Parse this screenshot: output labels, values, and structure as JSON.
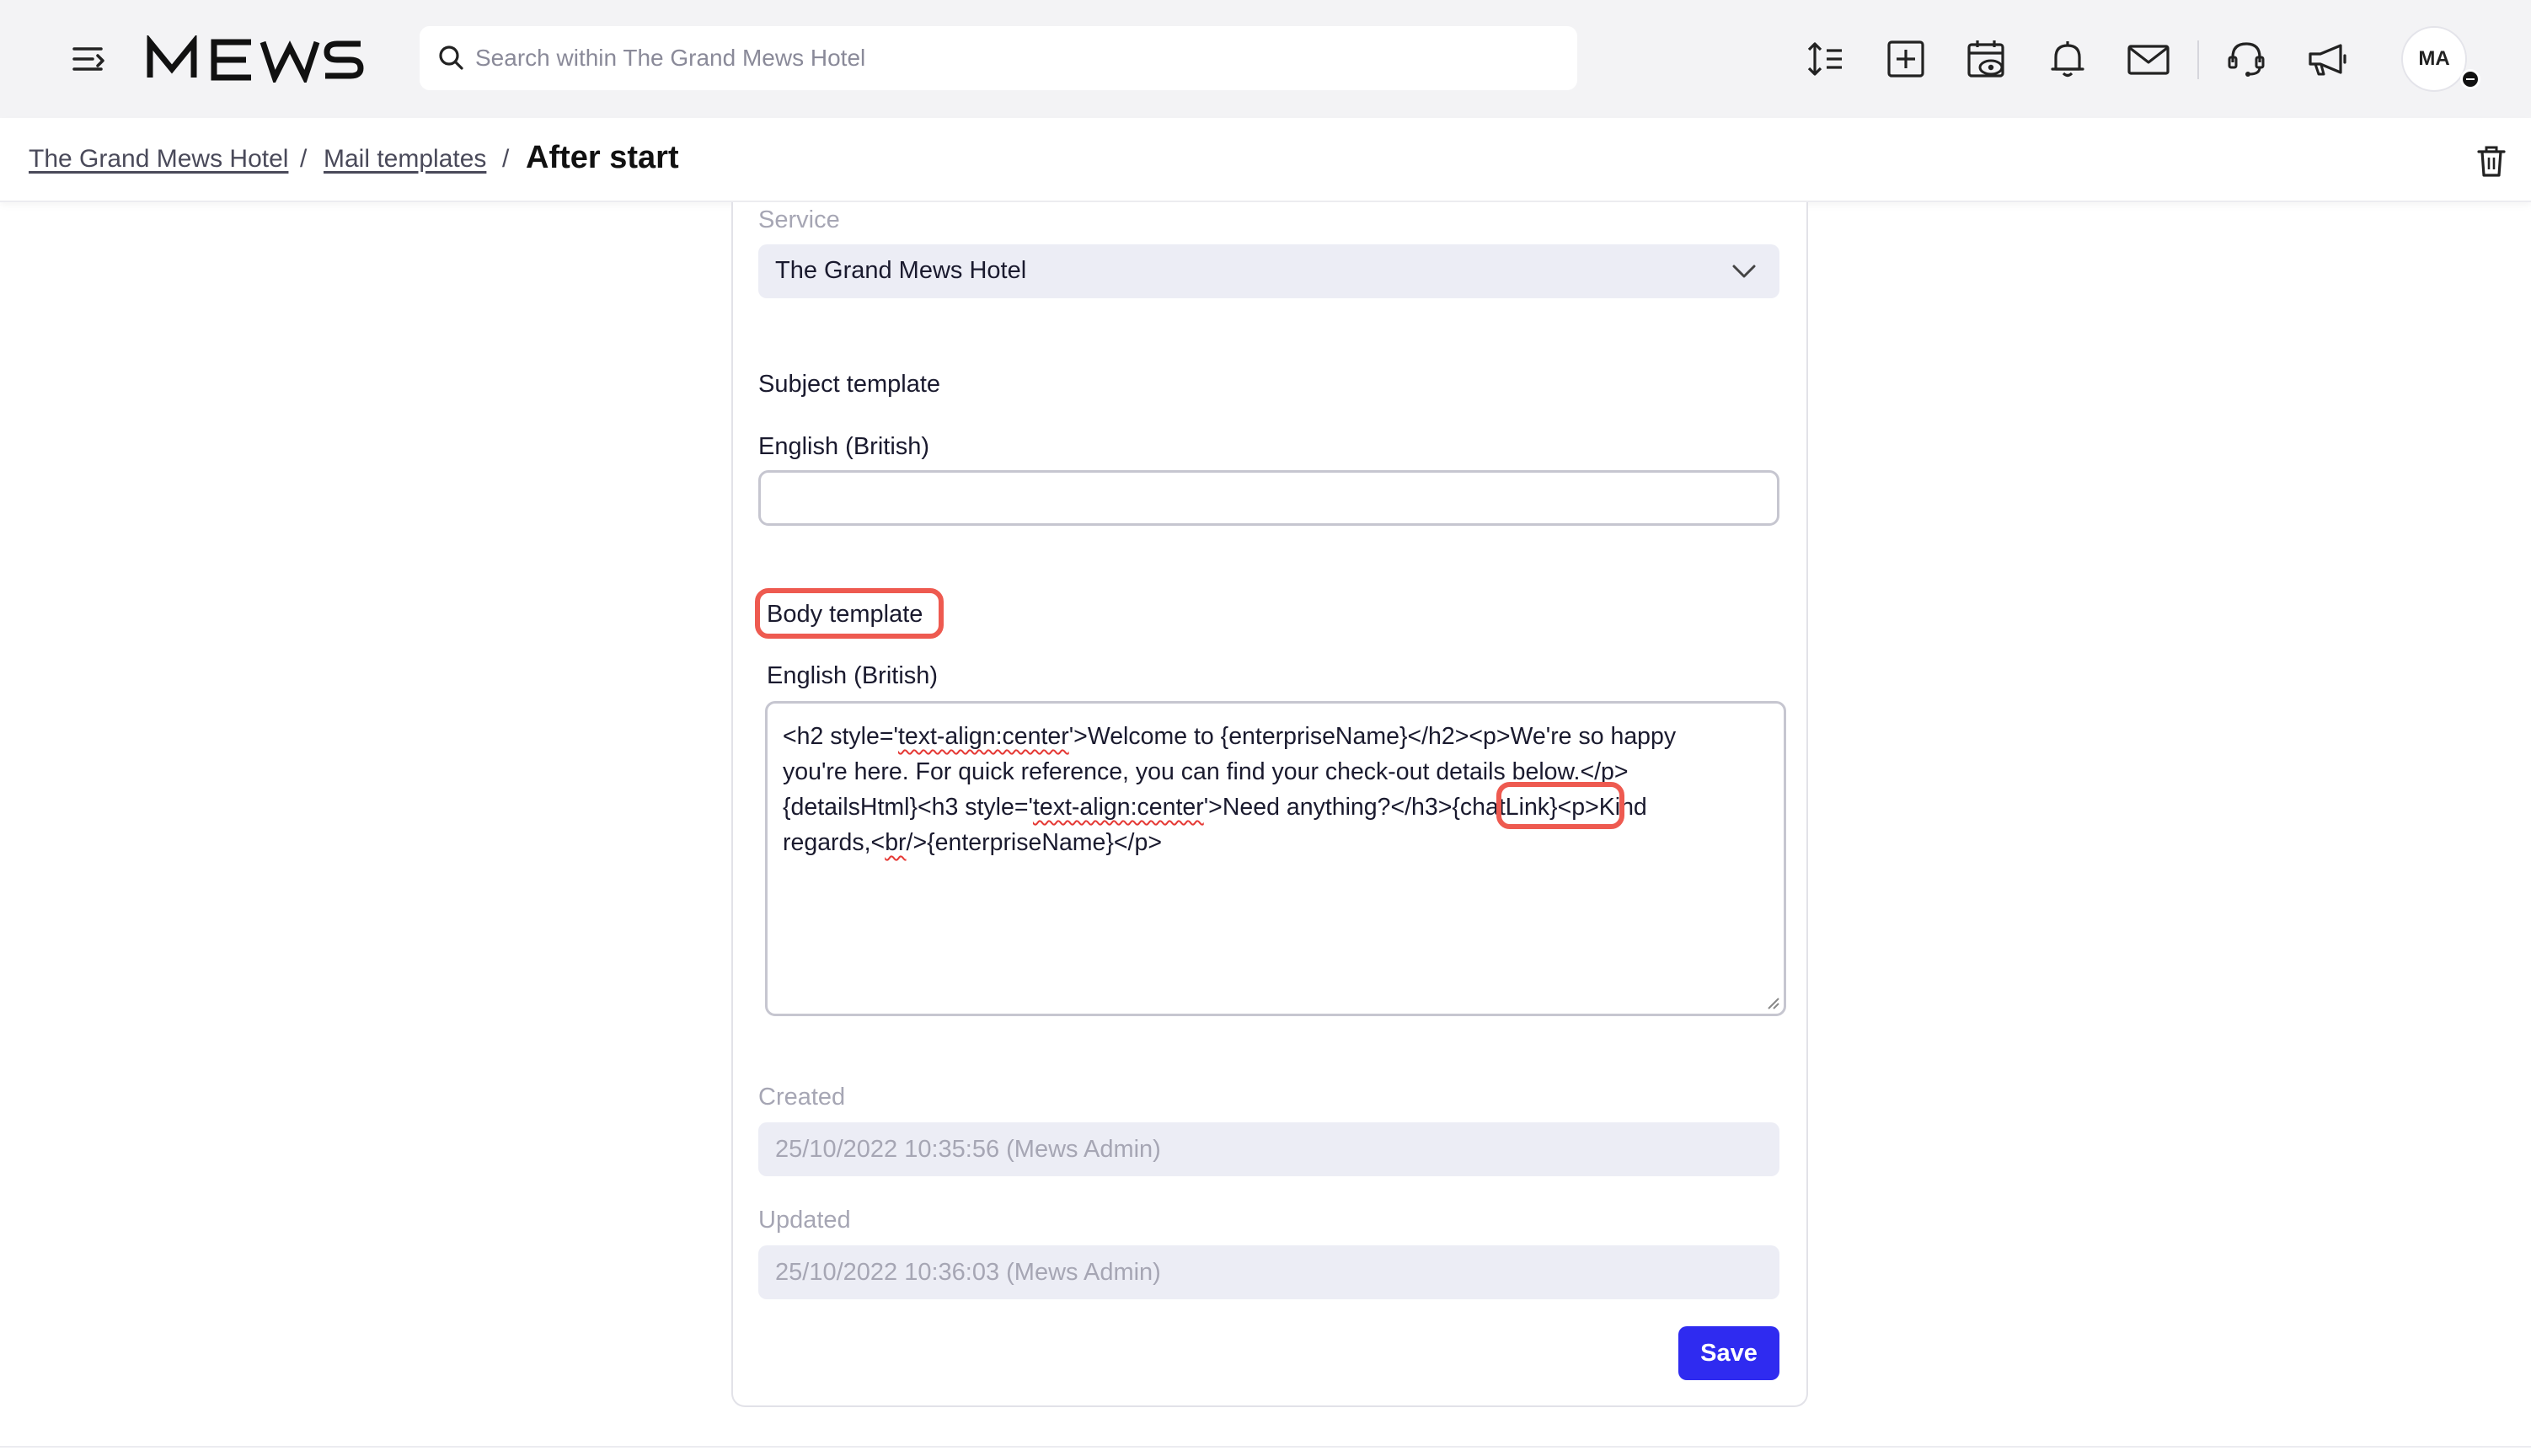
{
  "header": {
    "logo_text": "MEWS",
    "search_placeholder": "Search within The Grand Mews Hotel",
    "icons": [
      "hamburger-icon",
      "sort-icon",
      "add-icon",
      "calendar-eye-icon",
      "bell-icon",
      "mail-icon",
      "support-icon",
      "megaphone-icon"
    ],
    "avatar_initials": "MA"
  },
  "breadcrumb": {
    "items": [
      {
        "label": "The Grand Mews Hotel"
      },
      {
        "label": "Mail templates"
      }
    ],
    "separator": "/",
    "current": "After start"
  },
  "form": {
    "service_label": "Service",
    "service_value": "The Grand Mews Hotel",
    "subject_section": "Subject template",
    "subject_lang": "English (British)",
    "subject_value": "",
    "body_section": "Body template",
    "body_lang": "English (British)",
    "body_lines": {
      "l1a": "<h2 style='",
      "l1b": "text-align:center",
      "l1c": "'>Welcome to {enterpriseName}</h2><p>We're so happy",
      "l2": "you're here. For quick reference, you can find your check-out details below.</p>",
      "l3a": "{detailsHtml}<h3 style='",
      "l3b": "text-align:center",
      "l3c": "'>Need anything?</h3>",
      "l3d": "{chatLink}",
      "l3e": "<p>Kind",
      "l4a": "regards,<",
      "l4b": "br",
      "l4c": "/>{enterpriseName}</p>"
    },
    "created_label": "Created",
    "created_value": "25/10/2022 10:35:56 (Mews Admin)",
    "updated_label": "Updated",
    "updated_value": "25/10/2022 10:36:03 (Mews Admin)",
    "save_label": "Save"
  },
  "colors": {
    "accent": "#2f2bf0",
    "highlight": "#ee5a50",
    "spellcheck": "#e53935"
  }
}
